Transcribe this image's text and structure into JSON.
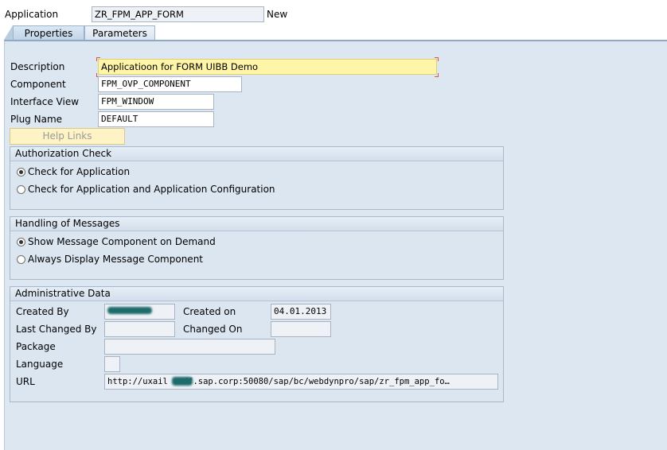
{
  "header": {
    "application_label": "Application",
    "application_value": "ZR_FPM_APP_FORM",
    "status": "New"
  },
  "tabs": [
    {
      "label": "Properties",
      "active": true
    },
    {
      "label": "Parameters",
      "active": false
    }
  ],
  "properties": {
    "description_label": "Description",
    "description_value": "Applicatioon for FORM UIBB Demo",
    "component_label": "Component",
    "component_value": "FPM_OVP_COMPONENT",
    "interface_view_label": "Interface View",
    "interface_view_value": "FPM_WINDOW",
    "plug_name_label": "Plug Name",
    "plug_name_value": "DEFAULT",
    "help_links_label": "Help Links"
  },
  "authorization_check": {
    "title": "Authorization Check",
    "options": [
      {
        "label": "Check for Application",
        "selected": true
      },
      {
        "label": "Check for Application and Application Configuration",
        "selected": false
      }
    ]
  },
  "handling_of_messages": {
    "title": "Handling of Messages",
    "options": [
      {
        "label": "Show Message Component on Demand",
        "selected": true
      },
      {
        "label": "Always Display Message Component",
        "selected": false
      }
    ]
  },
  "administrative_data": {
    "title": "Administrative Data",
    "created_by_label": "Created By",
    "created_by_value": "",
    "created_on_label": "Created on",
    "created_on_value": "04.01.2013",
    "last_changed_by_label": "Last Changed By",
    "last_changed_by_value": "",
    "changed_on_label": "Changed On",
    "changed_on_value": "",
    "package_label": "Package",
    "package_value": "",
    "language_label": "Language",
    "language_value": "",
    "url_label": "URL",
    "url_value": "http://uxail   .wdf.sap.corp:50080/sap/bc/webdynpro/sap/zr_fpm_app_fo…"
  },
  "colors": {
    "panel_bg": "#dde7f1",
    "highlight_field": "#fff5a8",
    "redaction": "#1e6b6b"
  }
}
